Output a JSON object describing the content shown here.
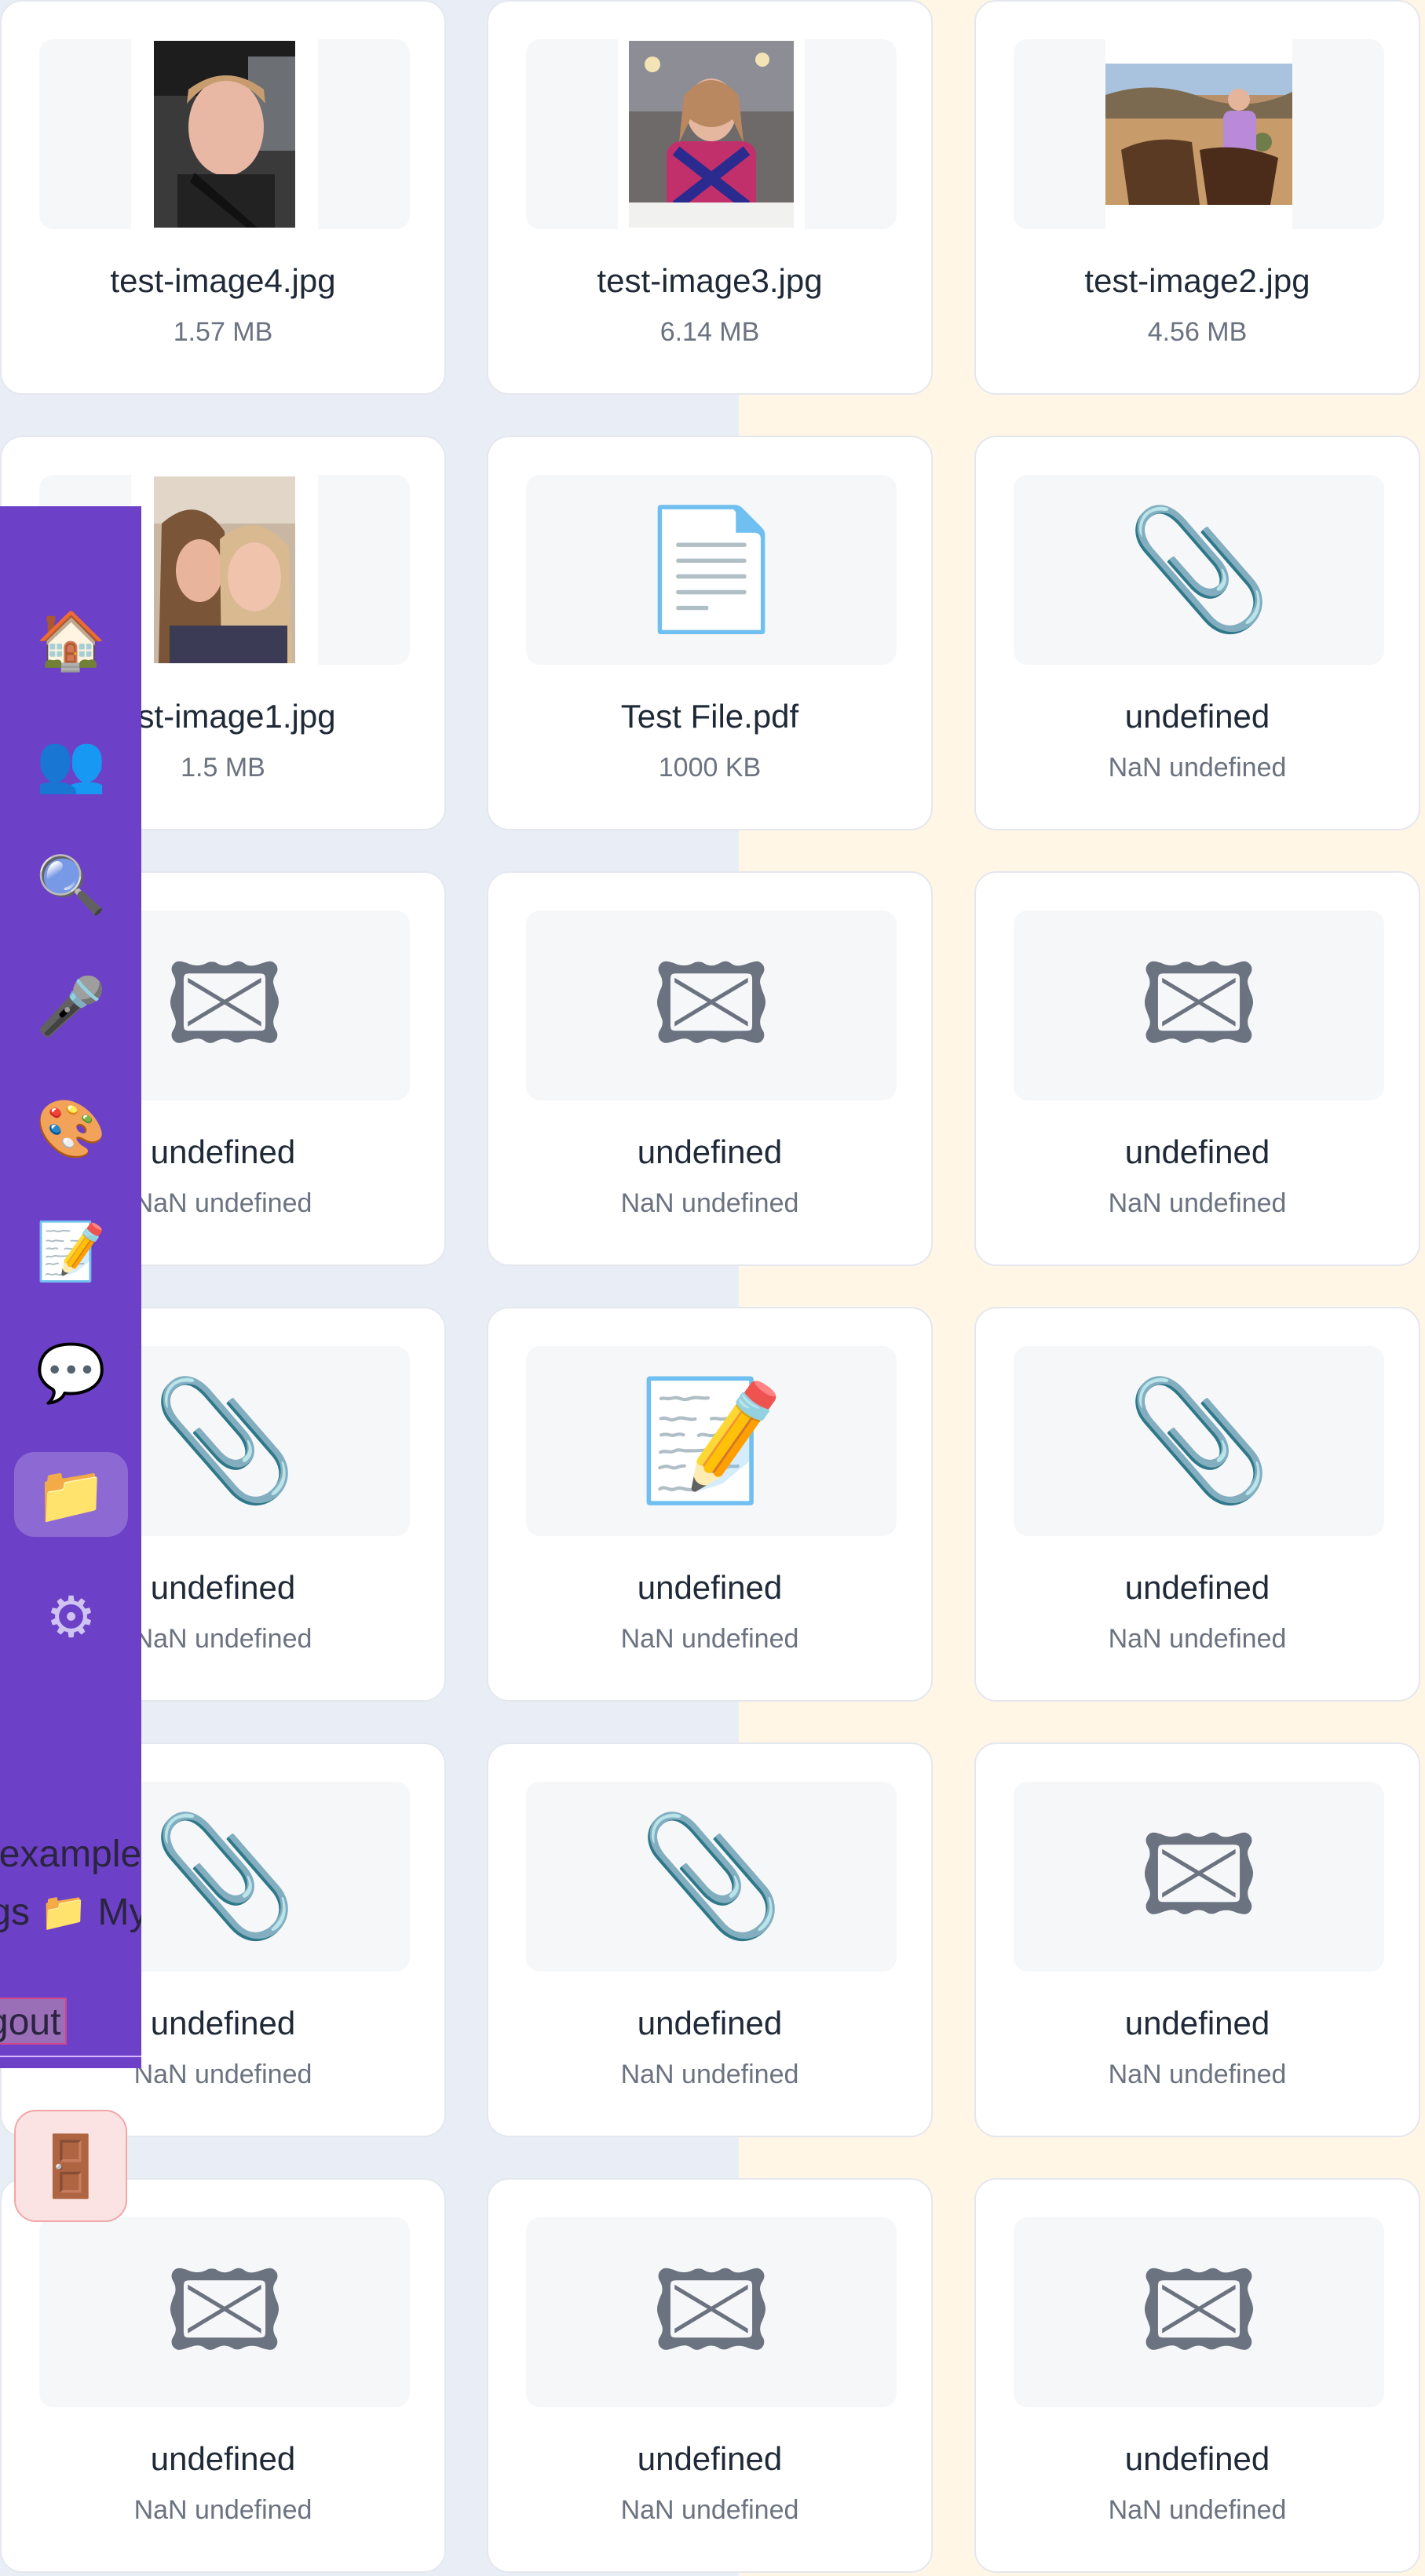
{
  "files": [
    {
      "name": "test-image4.jpg",
      "size": "1.57 MB",
      "thumb": "photo",
      "photo": "portrait-young-man-in-car"
    },
    {
      "name": "test-image3.jpg",
      "size": "6.14 MB",
      "thumb": "photo",
      "photo": "portrait-woman-at-table"
    },
    {
      "name": "test-image2.jpg",
      "size": "4.56 MB",
      "thumb": "photo",
      "photo": "rider-on-horse-desert"
    },
    {
      "name": "test-image1.jpg",
      "size": "1.5 MB",
      "thumb": "photo",
      "photo": "two-women-selfie"
    },
    {
      "name": "Test File.pdf",
      "size": "1000 KB",
      "thumb": "document",
      "icon": "📄"
    },
    {
      "name": "undefined",
      "size": "NaN undefined",
      "thumb": "clip",
      "icon": "📎"
    },
    {
      "name": "undefined",
      "size": "NaN undefined",
      "thumb": "frame",
      "icon": "🖾"
    },
    {
      "name": "undefined",
      "size": "NaN undefined",
      "thumb": "frame",
      "icon": "🖾"
    },
    {
      "name": "undefined",
      "size": "NaN undefined",
      "thumb": "frame",
      "icon": "🖾"
    },
    {
      "name": "undefined",
      "size": "NaN undefined",
      "thumb": "clip",
      "icon": "📎"
    },
    {
      "name": "undefined",
      "size": "NaN undefined",
      "thumb": "memo",
      "icon": "📝"
    },
    {
      "name": "undefined",
      "size": "NaN undefined",
      "thumb": "clip",
      "icon": "📎"
    },
    {
      "name": "undefined",
      "size": "NaN undefined",
      "thumb": "clip",
      "icon": "📎"
    },
    {
      "name": "undefined",
      "size": "NaN undefined",
      "thumb": "clip",
      "icon": "📎"
    },
    {
      "name": "undefined",
      "size": "NaN undefined",
      "thumb": "frame",
      "icon": "🖾"
    },
    {
      "name": "undefined",
      "size": "NaN undefined",
      "thumb": "frame",
      "icon": "🖾"
    },
    {
      "name": "undefined",
      "size": "NaN undefined",
      "thumb": "frame",
      "icon": "🖾"
    },
    {
      "name": "undefined",
      "size": "NaN undefined",
      "thumb": "frame",
      "icon": "🖾"
    }
  ],
  "sidebar": {
    "items": [
      {
        "icon": "🏠",
        "name": "home-icon"
      },
      {
        "icon": "👥",
        "name": "users-icon"
      },
      {
        "icon": "🔍",
        "name": "search-icon"
      },
      {
        "icon": "🎤",
        "name": "microphone-icon"
      },
      {
        "icon": "🎨",
        "name": "palette-icon"
      },
      {
        "icon": "📝",
        "name": "memo-icon"
      },
      {
        "icon": "💬",
        "name": "chat-icon"
      },
      {
        "icon": "📁",
        "name": "folder-icon",
        "active": true
      },
      {
        "icon": "⚙",
        "name": "gear-icon"
      }
    ],
    "user_email": "@example.com",
    "user_links": "ings 📁 My",
    "logout_label": "gout",
    "logout_icon": "🚪"
  },
  "colors": {
    "sidebar_bg": "#6d41c7",
    "page_bg_left": "#e9eef6",
    "page_bg_right": "#fff6e6",
    "card_bg": "#ffffff",
    "thumb_bg": "#f6f7f9",
    "logout_bg": "#fbe3e3"
  }
}
